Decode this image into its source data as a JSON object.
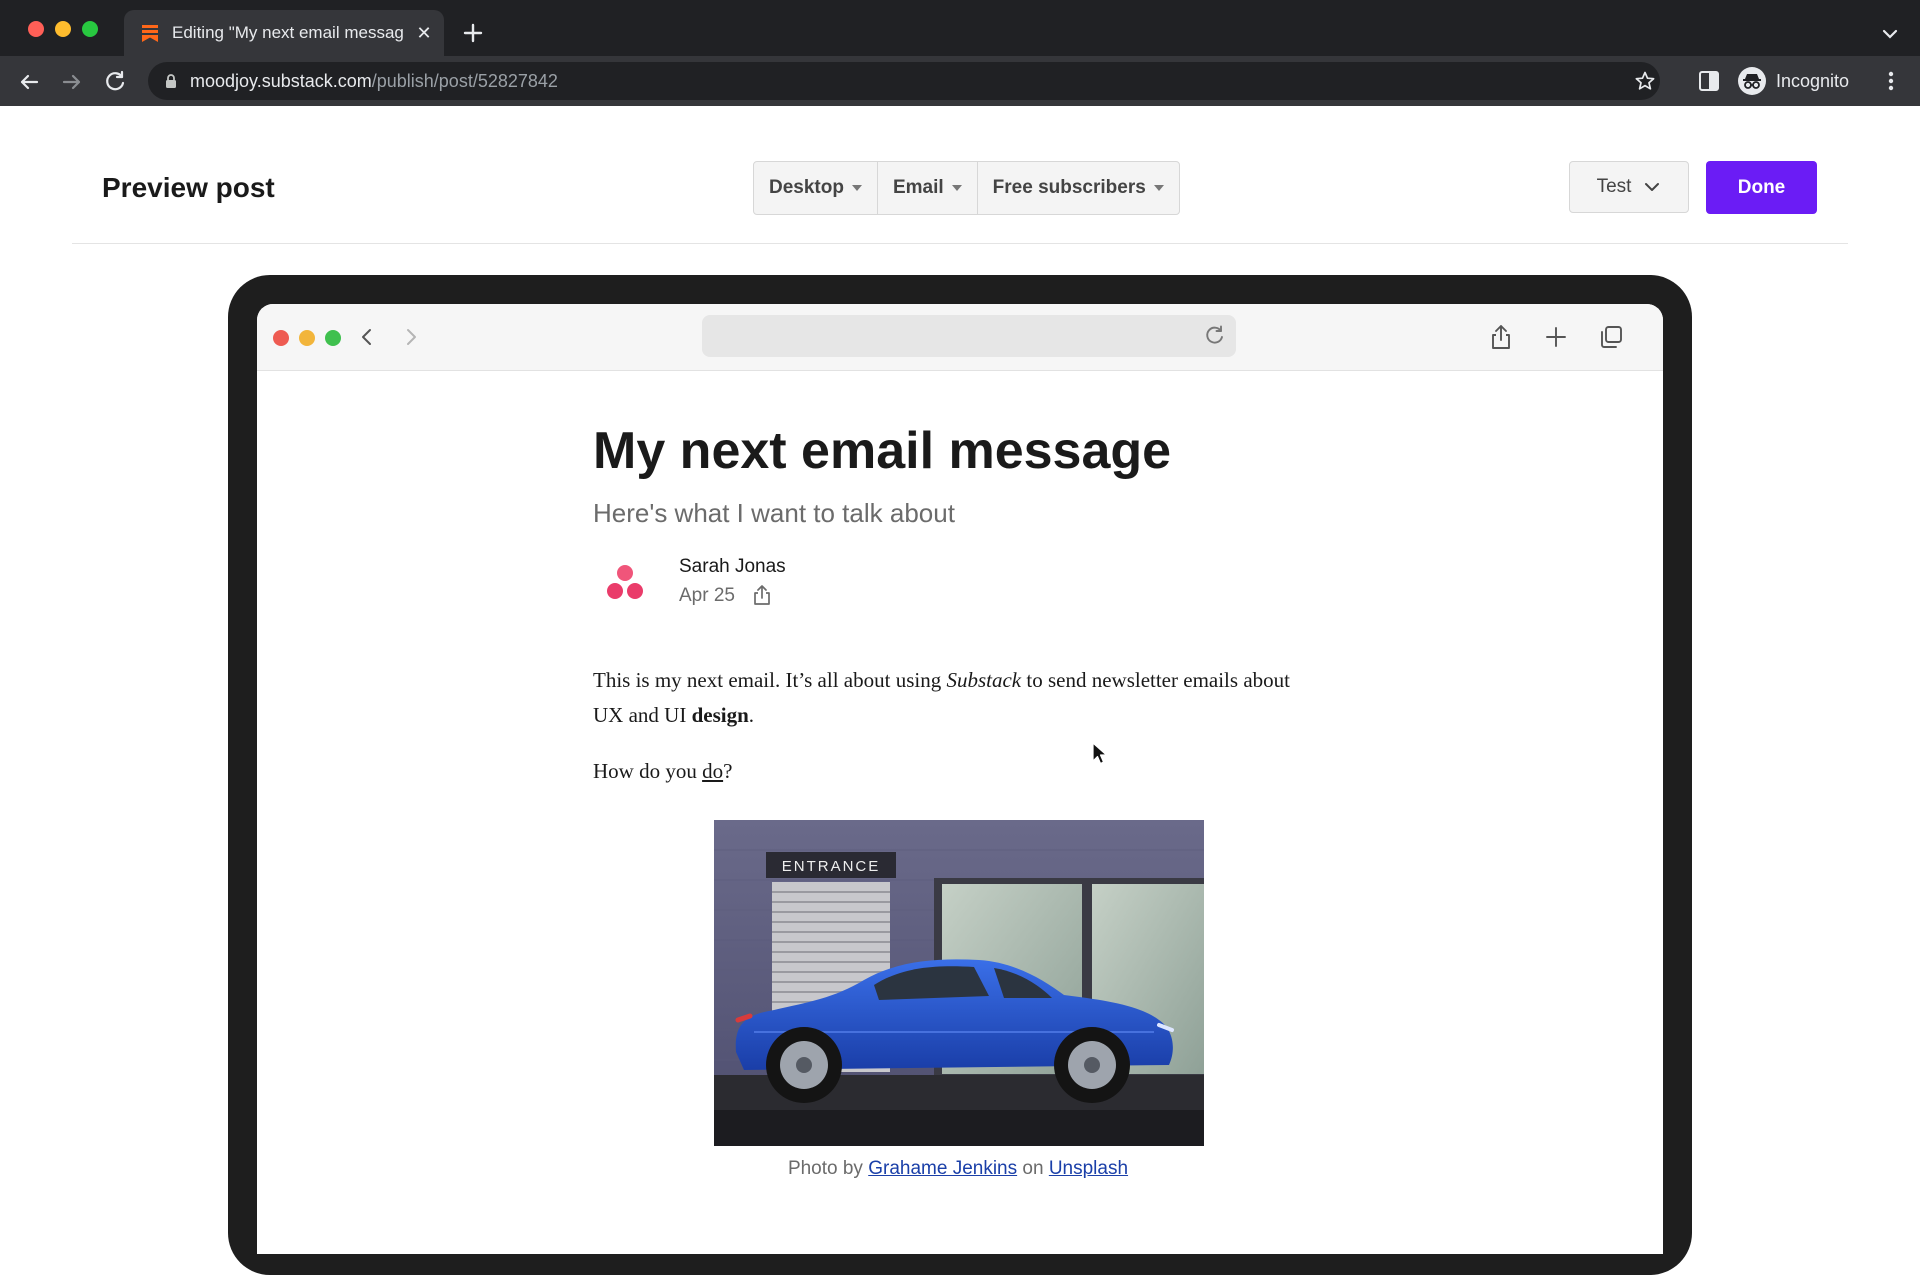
{
  "browser": {
    "tab_title": "Editing \"My next email messag",
    "url_host": "moodjoy.substack.com",
    "url_path": "/publish/post/52827842",
    "profile_label": "Incognito"
  },
  "header": {
    "title": "Preview post",
    "view_options": [
      {
        "label": "Desktop"
      },
      {
        "label": "Email"
      },
      {
        "label": "Free subscribers"
      }
    ],
    "test_label": "Test",
    "done_label": "Done"
  },
  "post": {
    "title": "My next email message",
    "subtitle": "Here's what I want to talk about",
    "author": "Sarah Jonas",
    "date": "Apr 25",
    "p1_a": "This is my next email. It’s all about using ",
    "p1_em": "Substack",
    "p1_b": " to send newsletter emails about UX and UI ",
    "p1_strong": "design",
    "p1_c": ".",
    "p2_a": "How do you ",
    "p2_link": "do",
    "p2_b": "?",
    "image_sign": "ENTRANCE",
    "caption_prefix": "Photo by ",
    "caption_author": "Grahame Jenkins",
    "caption_mid": " on ",
    "caption_source": "Unsplash"
  },
  "colors": {
    "accent": "#6b1cf5",
    "tab_favicon": "#ff6719",
    "car_blue": "#1f4fc4"
  }
}
